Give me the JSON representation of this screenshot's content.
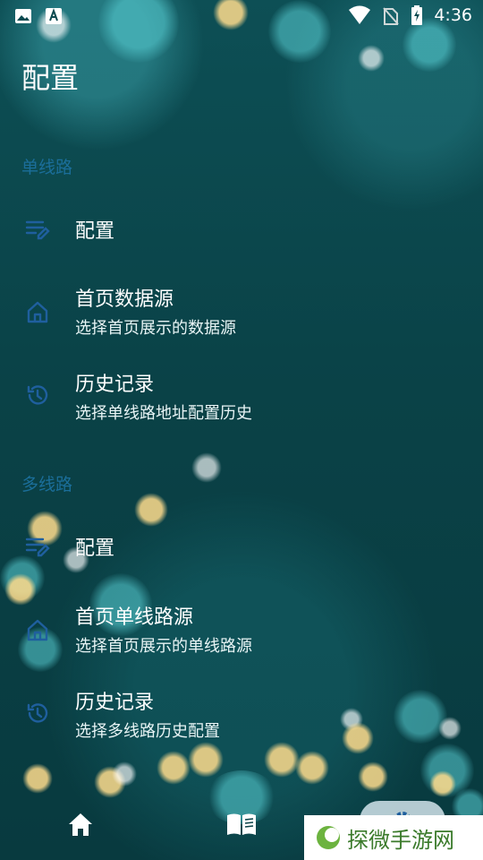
{
  "status_bar": {
    "time": "4:36",
    "left_icons": [
      "image-icon",
      "font-a-icon"
    ],
    "right_icons": [
      "wifi-icon",
      "no-sim-icon",
      "battery-charging-icon"
    ]
  },
  "page": {
    "title": "配置"
  },
  "sections": [
    {
      "header": "单线路",
      "items": [
        {
          "icon": "edit-list-icon",
          "title": "配置",
          "subtitle": ""
        },
        {
          "icon": "home-icon",
          "title": "首页数据源",
          "subtitle": "选择首页展示的数据源"
        },
        {
          "icon": "history-icon",
          "title": "历史记录",
          "subtitle": "选择单线路地址配置历史"
        }
      ]
    },
    {
      "header": "多线路",
      "items": [
        {
          "icon": "edit-list-icon",
          "title": "配置",
          "subtitle": ""
        },
        {
          "icon": "home-icon",
          "title": "首页单线路源",
          "subtitle": "选择首页展示的单线路源"
        },
        {
          "icon": "history-icon",
          "title": "历史记录",
          "subtitle": "选择多线路历史配置"
        }
      ]
    }
  ],
  "bottom_nav": {
    "items": [
      {
        "icon": "home-filled-icon",
        "selected": false
      },
      {
        "icon": "book-icon",
        "selected": false
      },
      {
        "icon": "settings-gear-icon",
        "selected": true
      }
    ]
  },
  "watermark": {
    "text": "探微手游网"
  },
  "colors": {
    "section_header": "#1b6e9a",
    "icon_blue": "#1f5f9e",
    "background": "#0a4247"
  }
}
